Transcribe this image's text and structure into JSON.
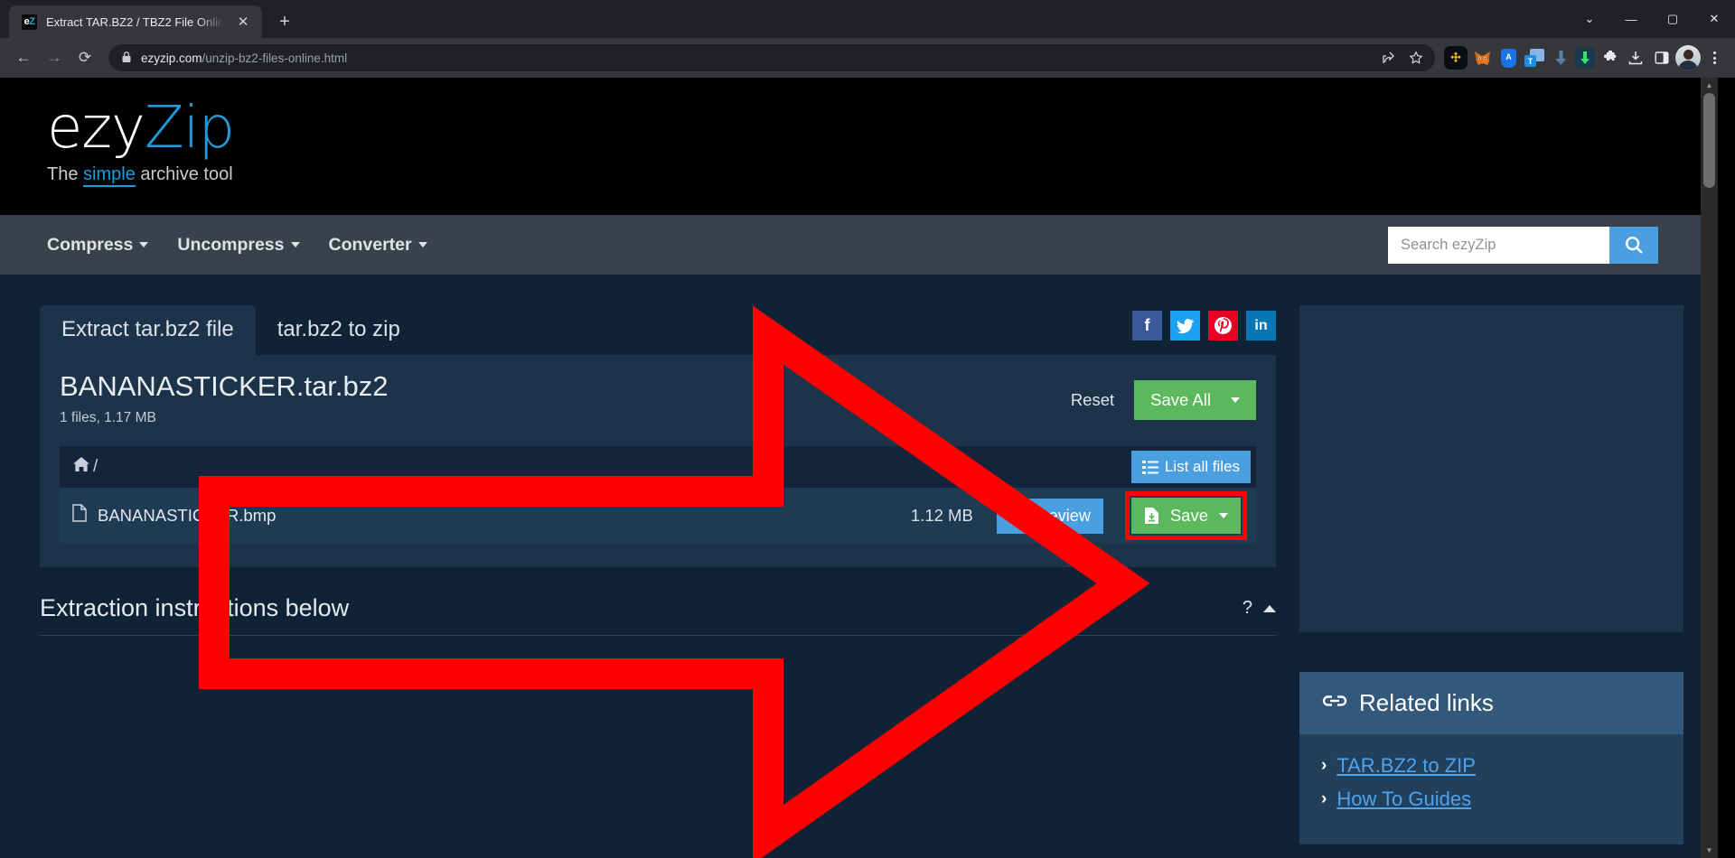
{
  "browser": {
    "tab": {
      "favicon_text_1": "e",
      "favicon_text_2": "Z",
      "title": "Extract TAR.BZ2 / TBZ2 File Onlin",
      "close_label": "✕"
    },
    "new_tab_label": "+",
    "window_controls": {
      "minimize": "—",
      "maximize": "▢",
      "close": "✕",
      "chevron": "⌄"
    },
    "nav": {
      "back": "←",
      "forward": "→",
      "reload": "⟳"
    },
    "omnibox": {
      "lock_icon": "🔒",
      "url_domain": "ezyzip.com",
      "url_path": "/unzip-bz2-files-online.html",
      "share_icon": "share-icon",
      "bookmark_icon": "★"
    },
    "extensions": [
      {
        "name": "binance-extension-icon",
        "glyph": "◈"
      },
      {
        "name": "metamask-extension-icon",
        "glyph": "🦊"
      },
      {
        "name": "blue-shield-extension-icon",
        "glyph": "A"
      },
      {
        "name": "text-doc-extension-icon",
        "glyph": "T"
      },
      {
        "name": "download-blue-arrow-icon",
        "glyph": "⬇"
      },
      {
        "name": "download-green-arrow-icon",
        "glyph": "⬇"
      },
      {
        "name": "puzzle-extensions-icon",
        "glyph": "🧩"
      },
      {
        "name": "downloads-tray-icon",
        "glyph": "⤓"
      },
      {
        "name": "side-panel-icon",
        "glyph": "▯"
      }
    ],
    "kebab_label": "⋮"
  },
  "site": {
    "logo": {
      "part1": "ezy",
      "part2": "Zip"
    },
    "tagline": {
      "pre": "The ",
      "highlight": "simple",
      "post": " archive tool"
    },
    "nav_links": [
      {
        "label": "Compress"
      },
      {
        "label": "Uncompress"
      },
      {
        "label": "Converter"
      }
    ],
    "search": {
      "placeholder": "Search ezyZip",
      "value": "",
      "button_icon": "search-icon"
    }
  },
  "main": {
    "tabs": [
      {
        "label": "Extract tar.bz2 file",
        "active": true
      },
      {
        "label": "tar.bz2 to zip",
        "active": false
      }
    ],
    "social": [
      {
        "name": "facebook",
        "glyph": "f",
        "color": "#3b5998"
      },
      {
        "name": "twitter",
        "glyph": "🐦",
        "color": "#1da1f2"
      },
      {
        "name": "pinterest",
        "glyph": "P",
        "color": "#e60023"
      },
      {
        "name": "linkedin",
        "glyph": "in",
        "color": "#0a77b5"
      }
    ],
    "archive": {
      "name": "BANANASTICKER.tar.bz2",
      "meta": "1 files, 1.17 MB",
      "reset_label": "Reset",
      "save_all_label": "Save All"
    },
    "breadcrumb": {
      "home_icon": "home-icon",
      "path": "/",
      "list_all_label": "List all files"
    },
    "files": [
      {
        "name": "BANANASTICKER.bmp",
        "size": "1.12 MB",
        "preview_label": "Preview",
        "save_label": "Save"
      }
    ],
    "instructions": {
      "title": "Extraction instructions below",
      "help_label": "?"
    }
  },
  "sidebar": {
    "related": {
      "icon": "link-icon",
      "title": "Related links",
      "links": [
        {
          "label": "TAR.BZ2 to ZIP"
        },
        {
          "label": "How To Guides"
        }
      ]
    }
  },
  "colors": {
    "accent_blue": "#4a9fe0",
    "green": "#5cb85c",
    "panel": "#1d3349",
    "page_bg": "#0f2236",
    "highlight_red": "#ff0000"
  }
}
